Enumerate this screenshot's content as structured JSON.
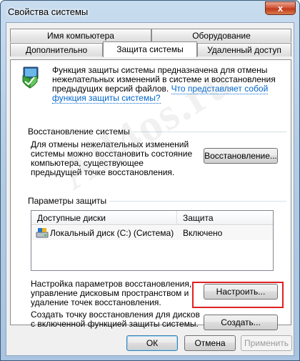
{
  "window": {
    "title": "Свойства системы",
    "close_label": "x"
  },
  "tabs": {
    "top_row": [
      "Имя компьютера",
      "Оборудование"
    ],
    "bottom_row": [
      "Дополнительно",
      "Защита системы",
      "Удаленный доступ"
    ],
    "active": "Защита системы"
  },
  "intro": {
    "text": "Функция защиты системы предназначена для отмены нежелательных изменений в системе и восстановления предыдущих версий файлов.",
    "link": "Что представляет собой функция защиты системы?",
    "icon": "shield-computer-icon"
  },
  "restore": {
    "group_title": "Восстановление системы",
    "description": "Для отмены нежелательных изменений системы можно восстановить состояние компьютера, существующее предыдущей точке восстановления.",
    "button": "Восстановление..."
  },
  "protection": {
    "group_title": "Параметры защиты",
    "columns": [
      "Доступные диски",
      "Защита"
    ],
    "rows": [
      {
        "disk": "Локальный диск (C:) (Система)",
        "status": "Включено",
        "icon": "drive-icon"
      }
    ],
    "configure_text": "Настройка параметров восстановления, управление дисковым пространством и удаление точек восстановления.",
    "configure_button": "Настроить...",
    "create_text": "Создать точку восстановления для дисков с включенной функцией защиты системы.",
    "create_button": "Создать..."
  },
  "footer": {
    "ok": "ОК",
    "cancel": "Отмена",
    "apply": "Применить"
  },
  "watermark": "All4os.ru",
  "colors": {
    "highlight": "#e02020",
    "link": "#0066cc"
  }
}
